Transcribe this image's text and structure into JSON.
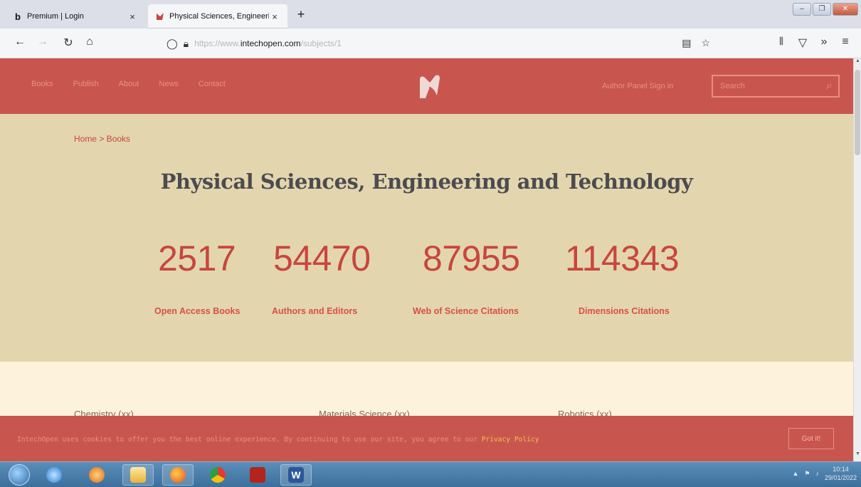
{
  "browser": {
    "tabs": [
      {
        "title": "Premium | Login",
        "icon": "b-logo-icon"
      },
      {
        "title": "Physical Sciences, Engineering",
        "icon": "intechopen-favicon-icon"
      }
    ],
    "new_tab_symbol": "+",
    "tab_close_symbol": "×",
    "url_prefix": "https://www.",
    "url_domain": "intechopen.com",
    "url_suffix": "/subjects/1"
  },
  "site": {
    "nav": [
      "Books",
      "Publish",
      "About",
      "News",
      "Contact"
    ],
    "auth": "Author Panel Sign in",
    "search_placeholder": "Search",
    "accent_color": "#c8564f"
  },
  "hero": {
    "breadcrumb": "Home > Books",
    "title": "Physical Sciences, Engineering and Technology",
    "stats": [
      {
        "value": "2517",
        "label": "Open Access Books"
      },
      {
        "value": "54470",
        "label": "Authors and Editors"
      },
      {
        "value": "87955",
        "label": "Web of Science Citations"
      },
      {
        "value": "114343",
        "label": "Dimensions Citations"
      }
    ]
  },
  "subjects": [
    "Chemistry (xx)",
    "Materials Science (xx)",
    "Robotics (xx)"
  ],
  "cookie": {
    "message": "IntechOpen uses cookies to offer you the best online experience. By continuing to use our site, you agree to our ",
    "policy_link": "Privacy Policy",
    "button": "Got it!"
  },
  "taskbar": {
    "time": "10:14",
    "date": "29/01/2022"
  }
}
